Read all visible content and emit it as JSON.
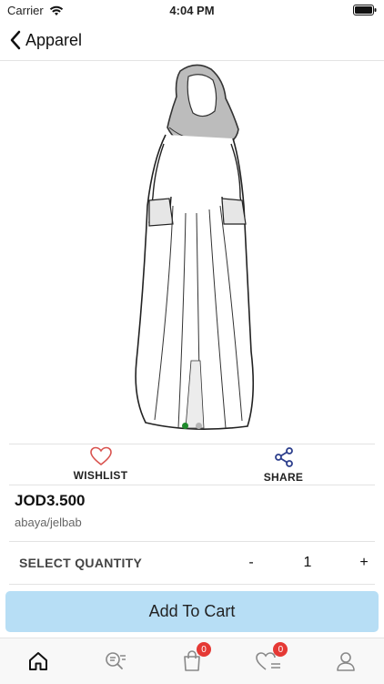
{
  "status_bar": {
    "carrier": "Carrier",
    "time": "4:04 PM"
  },
  "nav": {
    "title": "Apparel",
    "back_icon": "chevron-left-icon"
  },
  "product": {
    "image_icon": "abaya-illustration",
    "carousel": {
      "total": 2,
      "active_index": 0
    },
    "price": "JOD3.500",
    "category": "abaya/jelbab"
  },
  "actions": {
    "wishlist_label": "WISHLIST",
    "share_label": "SHARE"
  },
  "quantity": {
    "label": "SELECT QUANTITY",
    "minus": "-",
    "value": "1",
    "plus": "+"
  },
  "cart_button": {
    "label": "Add To Cart"
  },
  "tab_bar": {
    "cart_badge": "0",
    "wishlist_badge": "0",
    "active_tab": "home"
  },
  "colors": {
    "accent_button": "#b7def5",
    "badge": "#e53935",
    "dot_active": "#1f8a2c",
    "wishlist_heart": "#d9534f",
    "share_icon": "#2c3e8c"
  }
}
